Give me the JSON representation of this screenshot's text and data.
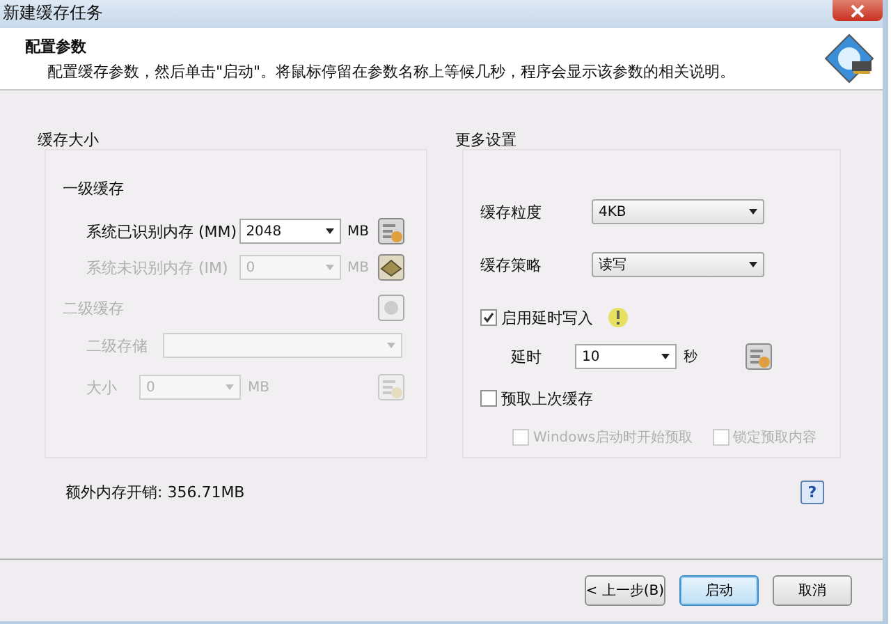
{
  "window": {
    "title": "新建缓存任务"
  },
  "header": {
    "title": "配置参数",
    "description": "配置缓存参数，然后单击\"启动\"。将鼠标停留在参数名称上等候几秒，程序会显示该参数的相关说明。"
  },
  "cache_size": {
    "title": "缓存大小",
    "level1": {
      "title": "一级缓存",
      "rows": [
        {
          "label": "系统已识别内存 (MM)",
          "value": "2048",
          "unit": "MB",
          "disabled": false
        },
        {
          "label": "系统未识别内存 (IM)",
          "value": "0",
          "unit": "MB",
          "disabled": true
        }
      ]
    },
    "level2": {
      "title": "二级缓存",
      "disabled": true,
      "storage": {
        "label": "二级存储",
        "disabled": true
      },
      "size": {
        "label": "大小",
        "value": "0",
        "unit": "MB",
        "disabled": true
      }
    }
  },
  "more_settings": {
    "title": "更多设置",
    "selects": [
      {
        "label": "缓存粒度",
        "value": "4KB"
      },
      {
        "label": "缓存策略",
        "value": "读写"
      }
    ],
    "delayed_write": {
      "label": "启用延时写入",
      "checked": true
    },
    "delay": {
      "label": "延时",
      "value": "10",
      "unit": "秒"
    },
    "prefetch": {
      "label": "预取上次缓存",
      "checked": false
    },
    "prefetch_options": [
      {
        "label": "Windows启动时开始预取",
        "checked": false,
        "disabled": true
      },
      {
        "label": "锁定预取内容",
        "checked": false,
        "disabled": true
      }
    ]
  },
  "overhead": "额外内存开销: 356.71MB",
  "help_button": "?",
  "buttons": [
    {
      "label": "< 上一步(B)",
      "default": false
    },
    {
      "label": "启动",
      "default": true
    },
    {
      "label": "取消",
      "default": false
    }
  ]
}
